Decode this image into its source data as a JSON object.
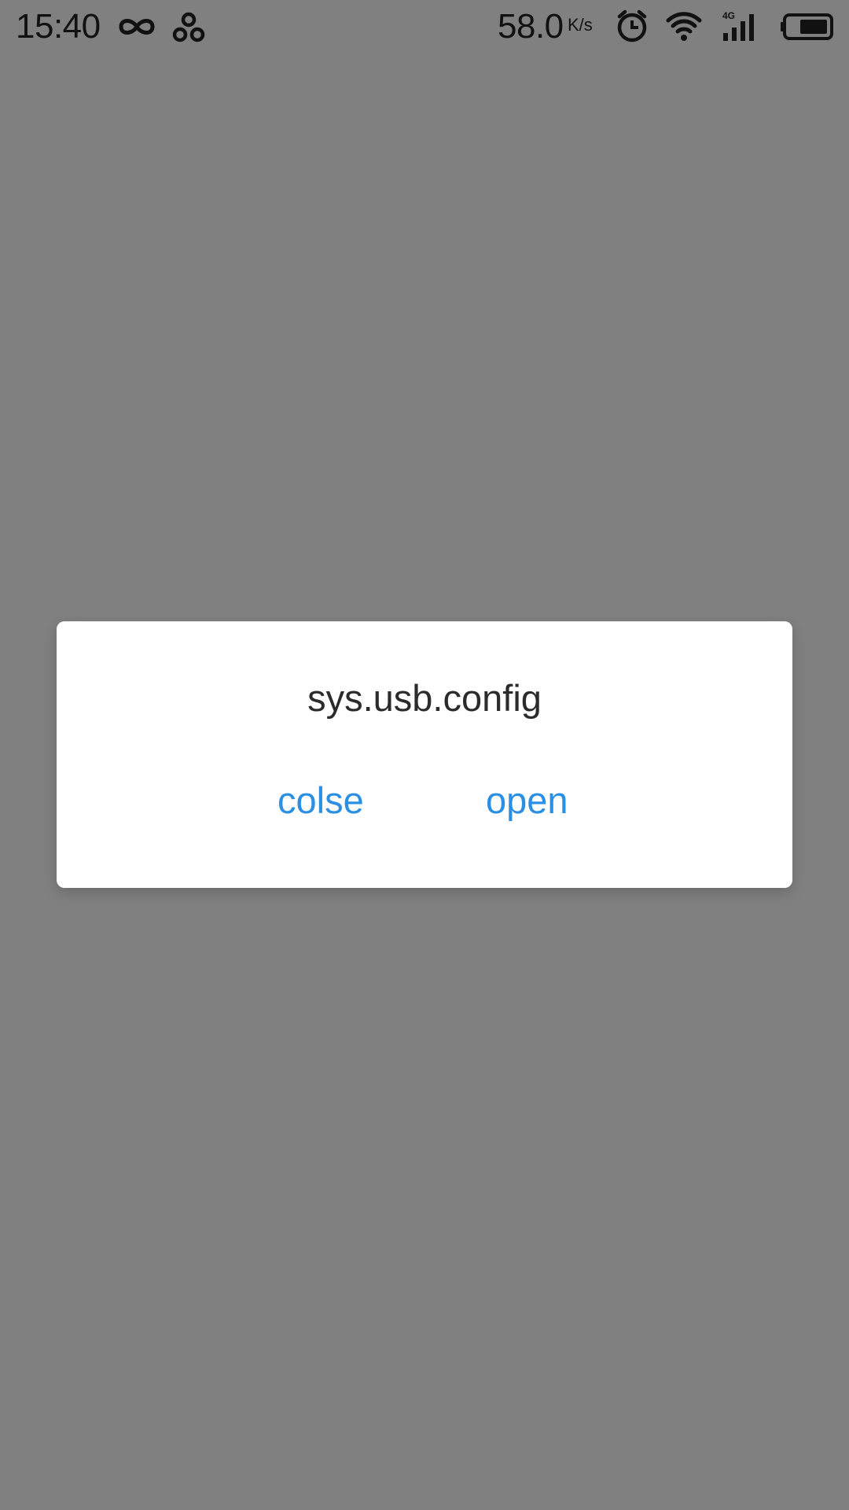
{
  "status_bar": {
    "time": "15:40",
    "net_speed": "58.0",
    "net_speed_unit": "K/s",
    "icons": [
      "infinity-icon",
      "cloverleaf-icon",
      "alarm-icon",
      "wifi-icon",
      "4g-signal-icon",
      "battery-icon"
    ],
    "signal_label": "4G"
  },
  "dialog": {
    "title": "sys.usb.config",
    "close_label": "colse",
    "open_label": "open"
  },
  "colors": {
    "background": "#808080",
    "dialog_bg": "#ffffff",
    "accent": "#2b8fe3",
    "title_text": "#2b2b2b"
  }
}
